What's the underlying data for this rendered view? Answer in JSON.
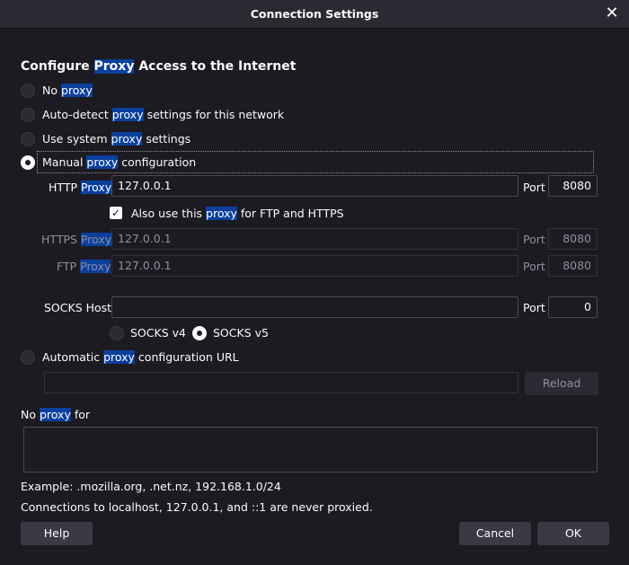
{
  "window": {
    "title": "Connection Settings"
  },
  "heading": {
    "pre": "Configure ",
    "hl": "Proxy",
    "post": " Access to the Internet"
  },
  "options": {
    "no_proxy": {
      "pre": "No ",
      "hl": "proxy",
      "post": ""
    },
    "auto_detect": {
      "pre": "Auto-detect ",
      "hl": "proxy",
      "post": " settings for this network"
    },
    "system": {
      "pre": "Use system ",
      "hl": "proxy",
      "post": " settings"
    },
    "manual": {
      "pre": "Manual ",
      "hl": "proxy",
      "post": " configuration",
      "checked": true
    }
  },
  "http": {
    "label_pre": "HTTP ",
    "label_hl": "Proxy",
    "value": "127.0.0.1",
    "port_label": "Port",
    "port": "8080"
  },
  "also_use": {
    "pre": "Also use this ",
    "hl": "proxy",
    "post": " for FTP and HTTPS",
    "checked": true
  },
  "https": {
    "label_pre": "HTTPS ",
    "label_hl": "Proxy",
    "value": "127.0.0.1",
    "port_label": "Port",
    "port": "8080"
  },
  "ftp": {
    "label_pre": "FTP ",
    "label_hl": "Proxy",
    "value": "127.0.0.1",
    "port_label": "Port",
    "port": "8080"
  },
  "socks": {
    "label": "SOCKS Host",
    "value": "",
    "port_label": "Port",
    "port": "0",
    "v4": "SOCKS v4",
    "v5": "SOCKS v5",
    "selected": "v5"
  },
  "auto_url": {
    "pre": "Automatic ",
    "hl": "proxy",
    "post": " configuration URL",
    "value": "",
    "reload": "Reload"
  },
  "no_proxy_for": {
    "pre": "No ",
    "hl": "proxy",
    "post": " for",
    "value": ""
  },
  "example": "Example: .mozilla.org, .net.nz, 192.168.1.0/24",
  "note": "Connections to localhost, 127.0.0.1, and ::1 are never proxied.",
  "buttons": {
    "help": "Help",
    "cancel": "Cancel",
    "ok": "OK"
  },
  "colors": {
    "background": "#1c1b22",
    "highlight": "#0b3f9e",
    "button": "#3a3944",
    "text": "#fbfbfe"
  },
  "icons": {
    "close": "close-icon",
    "check": "checkmark-icon"
  }
}
